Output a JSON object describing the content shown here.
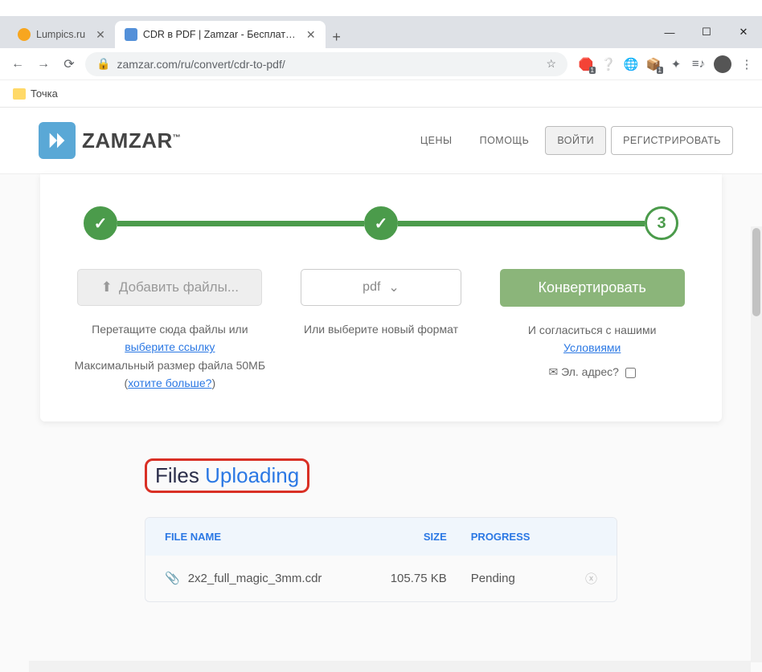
{
  "browser": {
    "tabs": [
      {
        "title": "Lumpics.ru"
      },
      {
        "title": "CDR в PDF | Zamzar - Бесплатна"
      }
    ],
    "url": "zamzar.com/ru/convert/cdr-to-pdf/",
    "bookmarks": [
      "Точка"
    ]
  },
  "header": {
    "logo": "ZAMZAR",
    "nav": {
      "pricing": "ЦЕНЫ",
      "help": "ПОМОЩЬ",
      "login": "ВОЙТИ",
      "register": "РЕГИСТРИРОВАТЬ"
    }
  },
  "converter": {
    "add_files": "Добавить файлы...",
    "format_selected": "pdf",
    "convert": "Конвертировать",
    "add_hint_1": "Перетащите сюда файлы или",
    "add_hint_link": "выберите ссылку",
    "add_hint_2": "Максимальный размер файла 50МБ (",
    "add_hint_more": "хотите больше?",
    "add_hint_close": ")",
    "format_hint": "Или выберите новый формат",
    "convert_hint_1": "И согласиться с нашими",
    "convert_hint_link": "Условиями",
    "email_label": "Эл. адрес?"
  },
  "files": {
    "title_1": "Files ",
    "title_2": "Uploading",
    "headers": {
      "name": "FILE NAME",
      "size": "SIZE",
      "progress": "PROGRESS"
    },
    "rows": [
      {
        "name": "2x2_full_magic_3mm.cdr",
        "size": "105.75 KB",
        "progress": "Pending"
      }
    ]
  }
}
